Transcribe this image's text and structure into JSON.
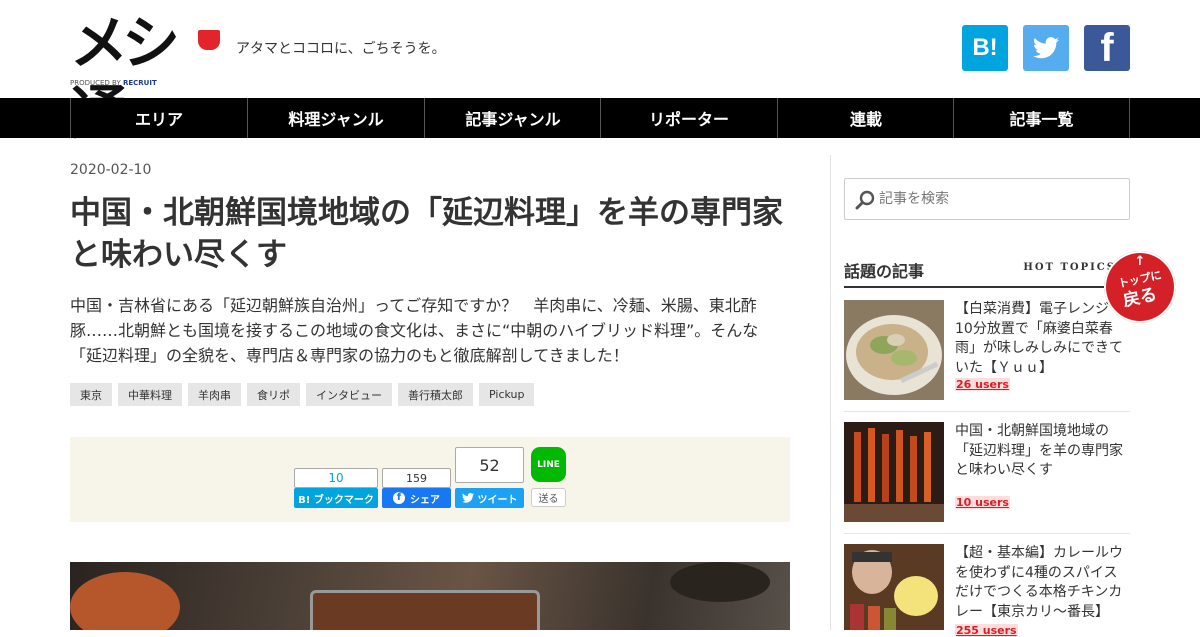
{
  "header": {
    "logo_text": "メシ通",
    "produced_by": "PRODUCED BY",
    "produced_brand": "RECRUIT",
    "tagline": "アタマとココロに、ごちそうを。",
    "social": {
      "hatena_label": "B!",
      "facebook_label": "f"
    }
  },
  "nav": {
    "items": [
      "エリア",
      "料理ジャンル",
      "記事ジャンル",
      "リポーター",
      "連載",
      "記事一覧"
    ]
  },
  "article": {
    "date": "2020-02-10",
    "title": "中国・北朝鮮国境地域の「延辺料理」を羊の専門家と味わい尽くす",
    "lead": "中国・吉林省にある「延辺朝鮮族自治州」ってご存知ですか？　羊肉串に、冷麺、米腸、東北酢豚……北朝鮮とも国境を接するこの地域の食文化は、まさに“中朝のハイブリッド料理”。そんな「延辺料理」の全貌を、専門店＆専門家の協力のもと徹底解剖してきました！",
    "tags": [
      "東京",
      "中華料理",
      "羊肉串",
      "食リポ",
      "インタビュー",
      "善行積太郎",
      "Pickup"
    ]
  },
  "share": {
    "hatena_count": "10",
    "hatena_label": "B! ブックマーク",
    "facebook_count": "159",
    "facebook_label": "シェア",
    "twitter_count": "52",
    "twitter_label": "ツイート",
    "line_logo": "LINE",
    "line_label": "送る"
  },
  "sidebar": {
    "search_placeholder": "記事を検索",
    "popular_title": "話題の記事",
    "popular_sub": "HOT TOPICS",
    "to_top_arrow": "↑",
    "to_top_line1": "トップに",
    "to_top_line2": "戻る",
    "items": [
      {
        "title": "【白菜消費】電子レンジで10分放置で「麻婆白菜春雨」が味しみしみにできていた【Ｙｕｕ】",
        "users": "26 users"
      },
      {
        "title": "中国・北朝鮮国境地域の「延辺料理」を羊の専門家と味わい尽くす",
        "users": "10 users"
      },
      {
        "title": "【超・基本編】カレールウを使わずに4種のスパイスだけでつくる本格チキンカレー【東京カリ～番長】",
        "users": "255 users"
      }
    ]
  },
  "colors": {
    "accent": "#d42128",
    "nav_bg": "#000000",
    "share_bg": "#f7f5e9"
  }
}
